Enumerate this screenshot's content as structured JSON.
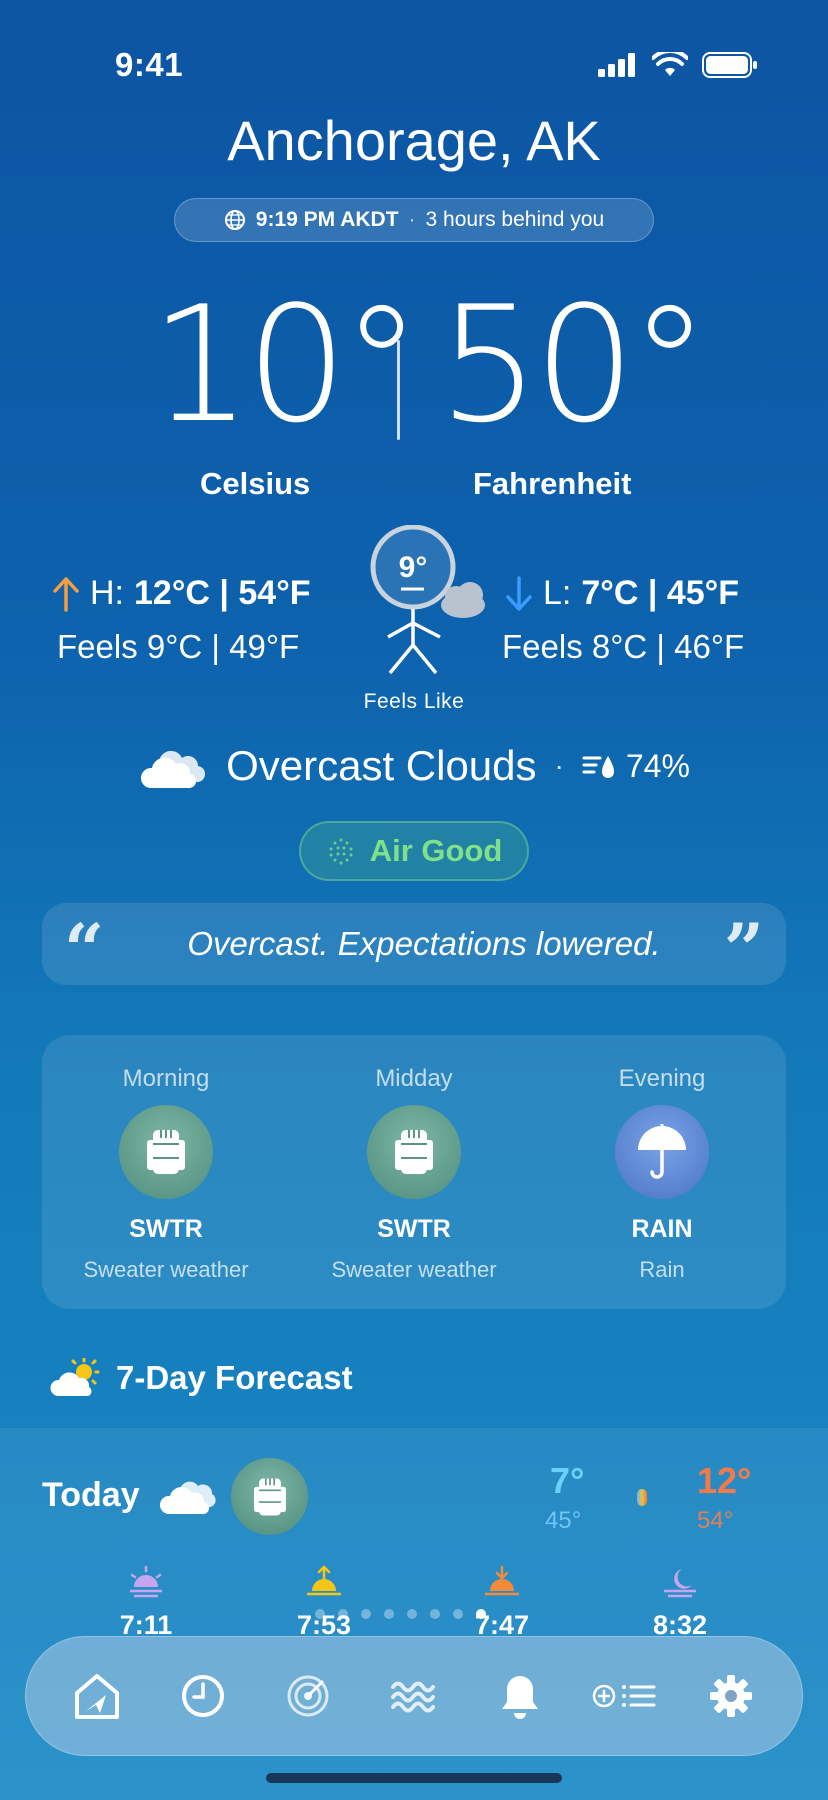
{
  "status_bar": {
    "time": "9:41"
  },
  "location": {
    "city": "Anchorage, AK",
    "local_time": "9:19 PM AKDT",
    "separator": "·",
    "offset_text": "3 hours behind you"
  },
  "current": {
    "temp_c": "10°",
    "temp_f": "50°",
    "unit_c_label": "Celsius",
    "unit_f_label": "Fahrenheit",
    "high_prefix": "H:",
    "high_value": "12°C | 54°F",
    "low_prefix": "L:",
    "low_value": "7°C | 45°F",
    "feels_high": "Feels 9°C | 49°F",
    "feels_low": "Feels 8°C | 46°F",
    "feels_like_temp": "9°",
    "feels_like_label": "Feels Like",
    "condition": "Overcast Clouds",
    "condition_sep": "·",
    "humidity": "74%",
    "air_quality": "Air Good",
    "quote": "Overcast. Expectations lowered."
  },
  "periods": [
    {
      "name": "Morning",
      "code": "SWTR",
      "desc": "Sweater weather",
      "icon": "sweater-icon",
      "color": "#4f8d7d"
    },
    {
      "name": "Midday",
      "code": "SWTR",
      "desc": "Sweater weather",
      "icon": "sweater-icon",
      "color": "#4f8d7d"
    },
    {
      "name": "Evening",
      "code": "RAIN",
      "desc": "Rain",
      "icon": "umbrella-icon",
      "color": "#4a74c6"
    }
  ],
  "forecast": {
    "title": "7-Day Forecast",
    "today": {
      "label": "Today",
      "low_c": "7°",
      "low_f": "45°",
      "high_c": "12°",
      "high_f": "54°"
    },
    "sun_times": [
      {
        "icon": "dawn-icon",
        "time": "7:11"
      },
      {
        "icon": "sunrise-icon",
        "time": "7:53"
      },
      {
        "icon": "sunset-icon",
        "time": "7:47"
      },
      {
        "icon": "moonrise-icon",
        "time": "8:32"
      }
    ]
  },
  "tabs": [
    "home-tab",
    "history-tab",
    "radar-tab",
    "wind-tab",
    "alerts-tab",
    "locations-tab",
    "settings-tab"
  ],
  "colors": {
    "accent_green": "#7fe08a",
    "low_blue": "#6fd0ff",
    "high_orange": "#f47a4a"
  }
}
